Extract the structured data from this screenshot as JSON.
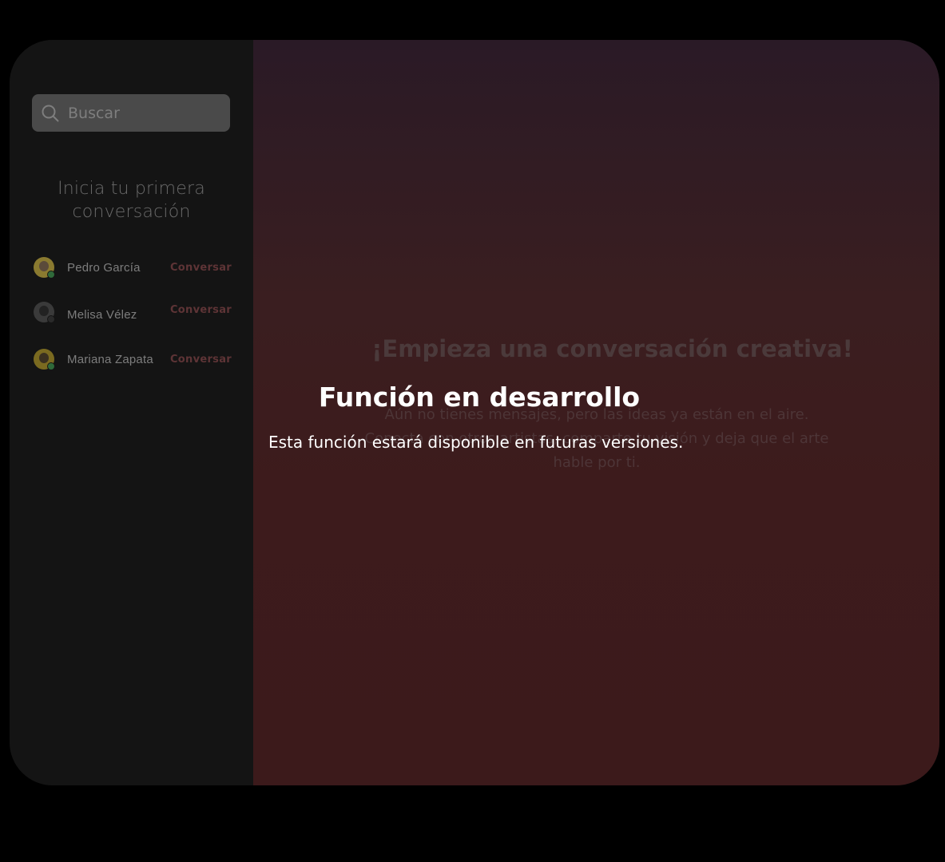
{
  "search": {
    "placeholder": "Buscar",
    "icon": "search-icon"
  },
  "sidebar": {
    "title": "Inicia tu primera conversación",
    "contacts": [
      {
        "name": "Pedro García",
        "action": "Conversar",
        "avatar_color": "#8a7a30",
        "status_color": "#2f6a3a"
      },
      {
        "name": "Melisa Vélez",
        "action": "Conversar",
        "avatar_color": "#3a3a3a",
        "status_color": "#2a2a2a"
      },
      {
        "name": "Mariana Zapata",
        "action": "Conversar",
        "avatar_color": "#7a6a20",
        "status_color": "#2f6a3a"
      }
    ]
  },
  "main": {
    "title": "¡Empieza una conversación creativa!",
    "description": "Aún no tienes mensajes, pero las ideas ya están en el aire. Conecta con otros artistas, comparte tu visión y deja que el arte hable por ti."
  },
  "overlay": {
    "title": "Función en desarrollo",
    "message": "Esta función estará disponible en futuras versiones."
  },
  "colors": {
    "background": "#000000",
    "sidebar": "#141414",
    "accent": "#5e3436",
    "main_gradient_end": "#3c1a1b"
  }
}
